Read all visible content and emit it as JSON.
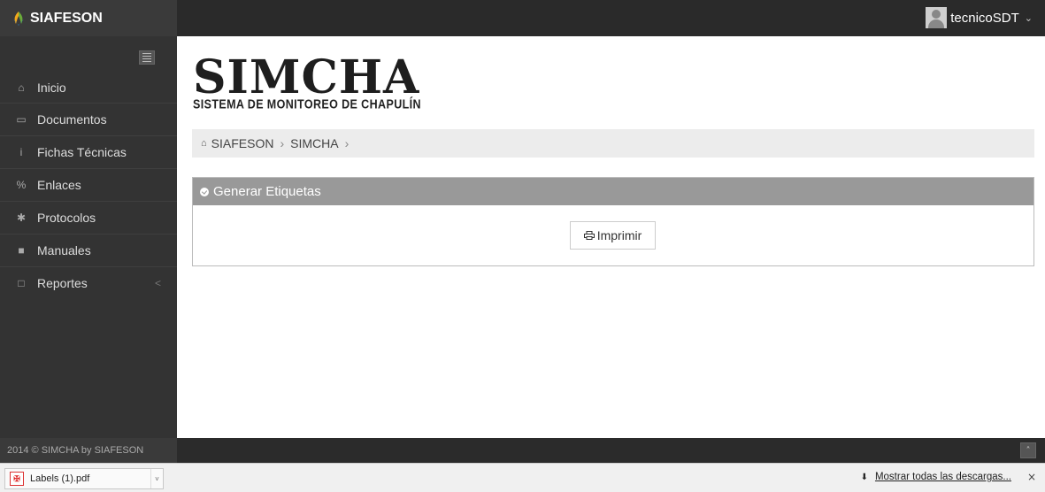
{
  "header": {
    "brand": "SIAFESON",
    "user_name": "tecnicoSDT",
    "user_caret": "⌄"
  },
  "sidebar": {
    "items": [
      {
        "icon": "home-icon",
        "glyph": "⌂",
        "label": "Inicio"
      },
      {
        "icon": "folder-icon",
        "glyph": "▭",
        "label": "Documentos"
      },
      {
        "icon": "info-icon",
        "glyph": "i",
        "label": "Fichas Técnicas"
      },
      {
        "icon": "link-icon",
        "glyph": "%",
        "label": "Enlaces"
      },
      {
        "icon": "gear-icon",
        "glyph": "✱",
        "label": "Protocolos"
      },
      {
        "icon": "book-icon",
        "glyph": "■",
        "label": "Manuales"
      },
      {
        "icon": "file-icon",
        "glyph": "□",
        "label": "Reportes",
        "chevron": "<"
      }
    ]
  },
  "main": {
    "logo_title": "SIMCHA",
    "logo_subtitle": "SISTEMA DE MONITOREO DE CHAPULÍN",
    "breadcrumb": {
      "home_glyph": "⌂",
      "items": [
        "SIAFESON",
        "SIMCHA"
      ],
      "separator": "›"
    },
    "panel": {
      "title": "Generar Etiquetas",
      "button_label": "Imprimir"
    }
  },
  "footer": {
    "copyright": "2014 © SIMCHA by SIAFESON",
    "scroll_glyph": "˄"
  },
  "downloads": {
    "file_name": "Labels (1).pdf",
    "file_glyph": "˅",
    "show_all": "Mostrar todas las descargas...",
    "show_all_glyph": "⬇",
    "close": "×"
  },
  "colors": {
    "topbar": "#2a2a2a",
    "sidebar": "#333333",
    "panel_header": "#999999"
  }
}
